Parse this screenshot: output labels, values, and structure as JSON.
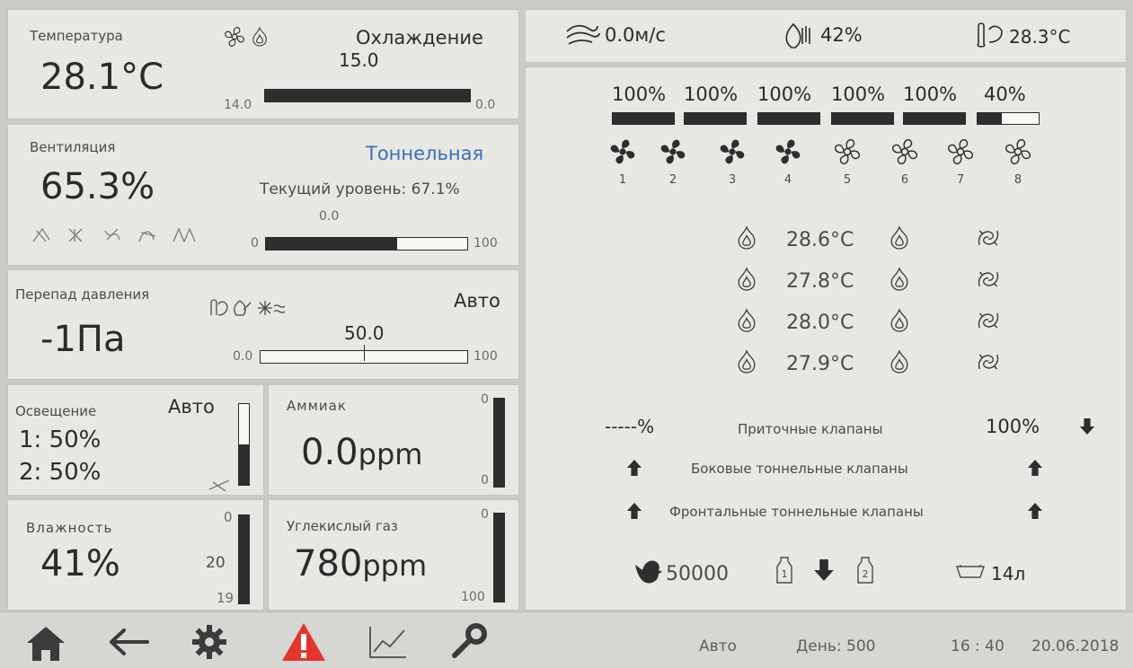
{
  "temperature": {
    "label": "Температура",
    "value": "28.1°C",
    "mode": "Охлаждение",
    "target": "15.0",
    "bar_left": "14.0",
    "bar_right": "0.0",
    "bar_fill": 1.0
  },
  "ventilation": {
    "label": "Вентиляция",
    "value": "65.3%",
    "mode": "Тоннельная",
    "current_level": "Текущий уровень: 67.1%",
    "bar_top": "0.0",
    "bar_left": "0",
    "bar_right": "100",
    "bar_fill": 0.65
  },
  "pressure": {
    "label": "Перепад давления",
    "value": "-1Па",
    "mode": "Авто",
    "setpoint": "50.0",
    "bar_left": "0.0",
    "bar_right": "100",
    "marker": 0.5
  },
  "lighting": {
    "label": "Освещение",
    "mode": "Авто",
    "line1": "1: 50%",
    "line2": "2: 50%",
    "bar_fill": 0.5
  },
  "ammonia": {
    "label": "Аммиак",
    "value": "0.0",
    "unit": "ppm",
    "bar_top": "0",
    "bar_bottom": "0",
    "bar_fill": 1.0
  },
  "humidity": {
    "label": "Влажность",
    "value": "41%",
    "bar_top": "0",
    "bar_mid": "20",
    "bar_bottom": "19",
    "bar_fill": 1.0
  },
  "co2": {
    "label": "Углекислый газ",
    "value": "780",
    "unit": "ppm",
    "bar_top": "0",
    "bar_bottom": "100",
    "bar_fill": 1.0
  },
  "top_status": {
    "wind": "0.0м/с",
    "humidity_out": "42%",
    "temp_out": "28.3°C"
  },
  "fans": {
    "groups": [
      {
        "pct": "100%",
        "fill": 1.0
      },
      {
        "pct": "100%",
        "fill": 1.0
      },
      {
        "pct": "100%",
        "fill": 1.0
      },
      {
        "pct": "100%",
        "fill": 1.0
      },
      {
        "pct": "100%",
        "fill": 1.0
      },
      {
        "pct": "40%",
        "fill": 0.4
      }
    ],
    "numbers": [
      "1",
      "2",
      "3",
      "4",
      "5",
      "6",
      "7",
      "8"
    ],
    "active": [
      true,
      true,
      true,
      true,
      false,
      false,
      false,
      false
    ]
  },
  "sensors": [
    "28.6°C",
    "27.8°C",
    "28.0°C",
    "27.9°C"
  ],
  "valves": {
    "inlet_left": "-----%",
    "inlet_label": "Приточные клапаны",
    "inlet_value": "100%",
    "side_label": "Боковые тоннельные клапаны",
    "front_label": "Фронтальные тоннельные клапаны"
  },
  "birds": {
    "count": "50000",
    "silo1": "1",
    "silo2": "2",
    "water": "14л"
  },
  "footer": {
    "mode": "Авто",
    "day": "День: 500",
    "time": "16 : 40",
    "date": "20.06.2018"
  },
  "colors": {
    "accent": "#3e6fb6",
    "alarm": "#e3352b",
    "dark": "#2d2f2e"
  },
  "icons": [
    "fan-icon",
    "heater-icon",
    "wind-icon",
    "humidity-icon",
    "thermometer-icon",
    "home-icon",
    "back-icon",
    "gear-icon",
    "alarm-icon",
    "chart-icon",
    "key-icon",
    "chicken-icon",
    "silo-icon",
    "water-trough-icon",
    "arrow-up-icon",
    "arrow-down-icon"
  ]
}
